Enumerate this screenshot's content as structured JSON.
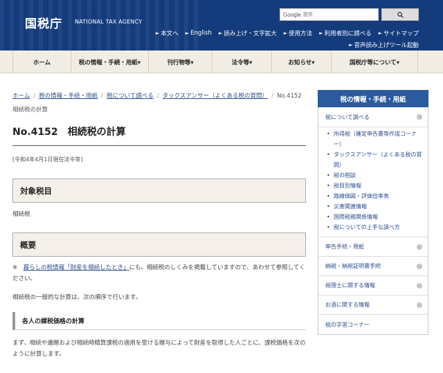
{
  "header": {
    "logo": "国税庁",
    "logo_en": "NATIONAL TAX AGENCY",
    "search_provider": "Google",
    "search_placeholder": "提供",
    "utility_row1": [
      "本文へ",
      "English",
      "読み上げ・文字拡大",
      "使用方法",
      "利用者別に調べる",
      "サイトマップ"
    ],
    "utility_row2": [
      "音声読み上げツール起動"
    ]
  },
  "nav": [
    {
      "label": "ホーム",
      "width": 84
    },
    {
      "label": "税の情報・手続・用紙▾",
      "width": 112
    },
    {
      "label": "刊行物等▾",
      "width": 92
    },
    {
      "label": "法令等▾",
      "width": 86
    },
    {
      "label": "お知らせ▾",
      "width": 86
    },
    {
      "label": "国税庁等について▾",
      "width": 126
    }
  ],
  "breadcrumb": {
    "items": [
      "ホーム",
      "税の情報・手続・用紙",
      "税について調べる",
      "タックスアンサー（よくある税の質問）"
    ],
    "current": "No.4152　相続税の計算"
  },
  "page": {
    "title": "No.4152　相続税の計算",
    "as_of": "[令和4年4月1日現在法令等]",
    "section1_title": "対象税目",
    "section1_body": "相続税",
    "section2_title": "概要",
    "note_prefix": "※　",
    "note_link": "暮らしの税情報「財産を相続したとき」",
    "note_rest": "にも、相続税のしくみを掲載していますので、あわせて参照してください。",
    "intro": "相続税の一般的な計算は、次の順序で行います。",
    "section3_title": "各人の課税価格の計算",
    "body": "まず、相続や遺贈および相続時精算課税の適用を受ける贈与によって財産を取得した人ごとに、課税価格を次のように計算します。"
  },
  "sidebar": {
    "title": "税の情報・手続・用紙",
    "first": "税について調べる",
    "sub_items": [
      "所得税（確定申告書等作成コーナー）",
      "タックスアンサー（よくある税の質問）",
      "税の相談",
      "税目別情報",
      "路線価図・評価倍率表",
      "災害関連情報",
      "国際税務関係情報",
      "税についての上手な調べ方"
    ],
    "links": [
      "申告手続・用紙",
      "納税・納税証明書手続",
      "税理士に関する情報",
      "お酒に関する情報",
      "税の学習コーナー"
    ]
  }
}
